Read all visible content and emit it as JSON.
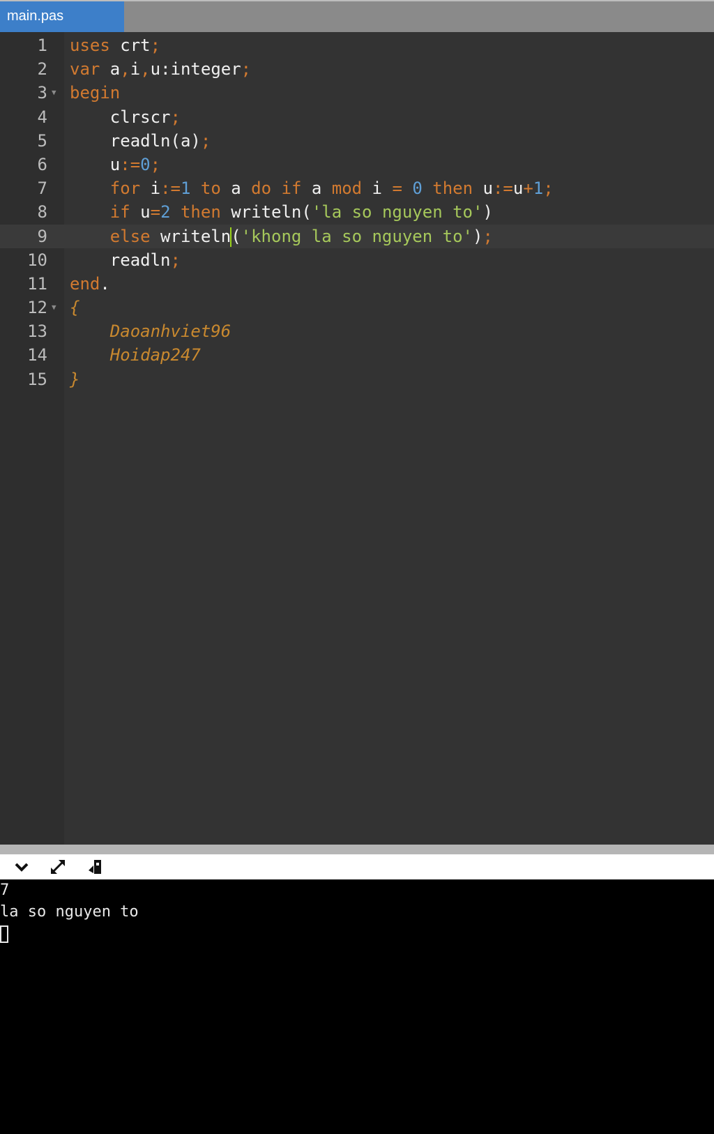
{
  "tabs": [
    {
      "label": "main.pas",
      "active": true
    }
  ],
  "editor": {
    "active_line": 9,
    "lines": [
      {
        "n": "1",
        "fold": false
      },
      {
        "n": "2",
        "fold": false
      },
      {
        "n": "3",
        "fold": true
      },
      {
        "n": "4",
        "fold": false
      },
      {
        "n": "5",
        "fold": false
      },
      {
        "n": "6",
        "fold": false
      },
      {
        "n": "7",
        "fold": false
      },
      {
        "n": "8",
        "fold": false
      },
      {
        "n": "9",
        "fold": false
      },
      {
        "n": "10",
        "fold": false
      },
      {
        "n": "11",
        "fold": false
      },
      {
        "n": "12",
        "fold": true
      },
      {
        "n": "13",
        "fold": false
      },
      {
        "n": "14",
        "fold": false
      },
      {
        "n": "15",
        "fold": false
      }
    ],
    "code": [
      [
        [
          "kw",
          "uses"
        ],
        [
          "id",
          " crt"
        ],
        [
          "pn",
          ";"
        ]
      ],
      [
        [
          "kw",
          "var"
        ],
        [
          "id",
          " a"
        ],
        [
          "pn",
          ","
        ],
        [
          "id",
          "i"
        ],
        [
          "pn",
          ","
        ],
        [
          "id",
          "u:integer"
        ],
        [
          "pn",
          ";"
        ]
      ],
      [
        [
          "kw",
          "begin"
        ]
      ],
      [
        [
          "id",
          "    clrscr"
        ],
        [
          "pn",
          ";"
        ]
      ],
      [
        [
          "id",
          "    readln(a)"
        ],
        [
          "pn",
          ";"
        ]
      ],
      [
        [
          "id",
          "    u"
        ],
        [
          "pn",
          ":="
        ],
        [
          "num",
          "0"
        ],
        [
          "pn",
          ";"
        ]
      ],
      [
        [
          "kw",
          "    for"
        ],
        [
          "id",
          " i"
        ],
        [
          "pn",
          ":="
        ],
        [
          "num",
          "1"
        ],
        [
          "kw",
          " to"
        ],
        [
          "id",
          " a"
        ],
        [
          "kw",
          " do"
        ],
        [
          "kw",
          " if"
        ],
        [
          "id",
          " a"
        ],
        [
          "kw",
          " mod"
        ],
        [
          "id",
          " i"
        ],
        [
          "pn",
          " ="
        ],
        [
          "num",
          " 0"
        ],
        [
          "kw",
          " then"
        ],
        [
          "id",
          " u"
        ],
        [
          "pn",
          ":="
        ],
        [
          "id",
          "u"
        ],
        [
          "pn",
          "+"
        ],
        [
          "num",
          "1"
        ],
        [
          "pn",
          ";"
        ]
      ],
      [
        [
          "kw",
          "    if"
        ],
        [
          "id",
          " u"
        ],
        [
          "pn",
          "="
        ],
        [
          "num",
          "2"
        ],
        [
          "kw",
          " then"
        ],
        [
          "id",
          " writeln("
        ],
        [
          "str",
          "'la so nguyen to'"
        ],
        [
          "id",
          ")"
        ]
      ],
      [
        [
          "kw",
          "    else"
        ],
        [
          "id",
          " writeln"
        ],
        [
          "cursor",
          ""
        ],
        [
          "id",
          "("
        ],
        [
          "str",
          "'khong la so nguyen to'"
        ],
        [
          "id",
          ")"
        ],
        [
          "pn",
          ";"
        ]
      ],
      [
        [
          "id",
          "    readln"
        ],
        [
          "pn",
          ";"
        ]
      ],
      [
        [
          "kw",
          "end"
        ],
        [
          "id",
          "."
        ]
      ],
      [
        [
          "cm",
          "{"
        ]
      ],
      [
        [
          "cm",
          "    Daoanhviet96"
        ]
      ],
      [
        [
          "cm",
          "    Hoidap247"
        ]
      ],
      [
        [
          "cm",
          "}"
        ]
      ]
    ]
  },
  "console_toolbar": {
    "buttons": [
      {
        "name": "collapse-console-button",
        "icon": "chevron-down-icon",
        "glyph": "⌄"
      },
      {
        "name": "expand-console-button",
        "icon": "expand-icon",
        "glyph": "⤢"
      },
      {
        "name": "clear-console-button",
        "icon": "clear-icon",
        "glyph": "⌫"
      }
    ]
  },
  "console": {
    "output": [
      "7",
      "la so nguyen to"
    ]
  },
  "colors": {
    "keyword": "#d27a30",
    "number": "#5f9fd6",
    "string": "#a6c85b",
    "comment": "#c9892f",
    "tab_active": "#3d7fc9"
  }
}
